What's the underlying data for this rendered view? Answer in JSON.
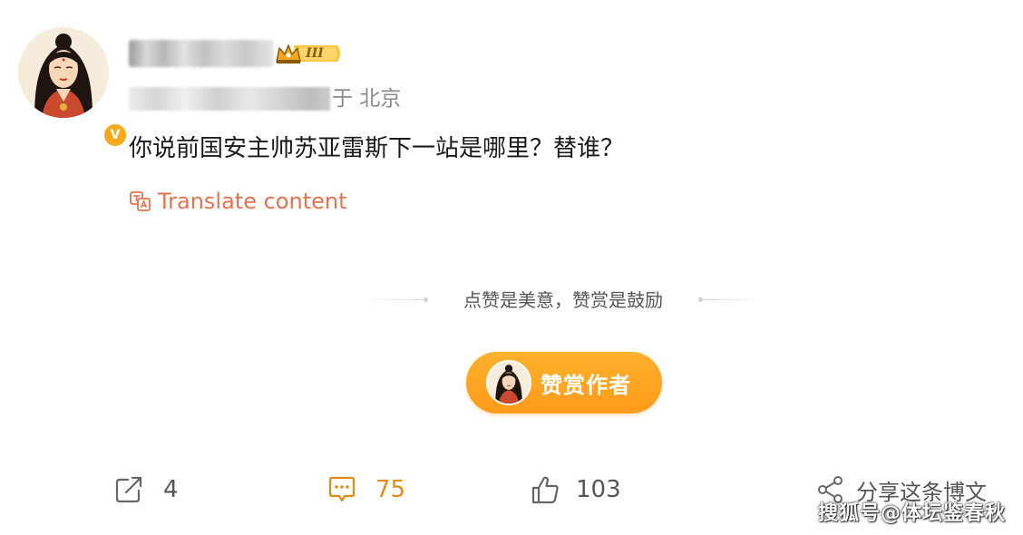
{
  "post": {
    "location": "于 北京",
    "text": "你说前国安主帅苏亚雷斯下一站是哪里？替谁？",
    "translate_label": "Translate content"
  },
  "author": {
    "avatar": "woman-portrait-avatar",
    "verified": "orange-v-badge",
    "vip_badge": {
      "icon": "crown-icon",
      "level_text": "III",
      "color": "#f7b928"
    }
  },
  "reward": {
    "tagline": "点赞是美意，赞赏是鼓励",
    "button_label": "赞赏作者",
    "button_color": "#ff9f1c"
  },
  "actions": {
    "repost": {
      "icon": "repost-icon",
      "count": "4"
    },
    "comment": {
      "icon": "comment-icon",
      "count": "75",
      "color": "#e58a18"
    },
    "like": {
      "icon": "thumbs-up-icon",
      "count": "103"
    },
    "share": {
      "icon": "share-icon",
      "label": "分享这条博文"
    }
  },
  "watermark": {
    "text": "搜狐号@体坛鉴春秋"
  }
}
